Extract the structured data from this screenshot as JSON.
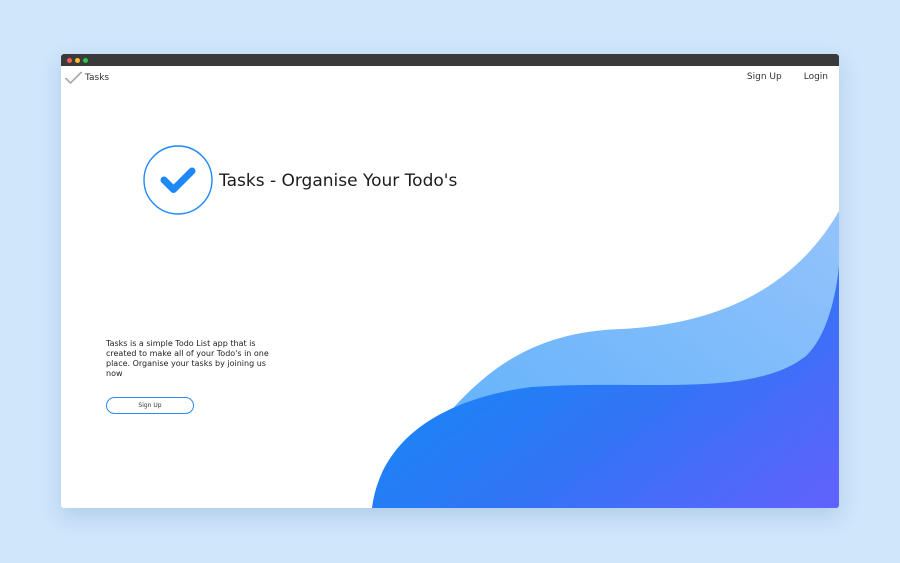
{
  "navbar": {
    "brand": "Tasks",
    "links": [
      "Sign Up",
      "Login"
    ]
  },
  "hero": {
    "title": "Tasks - Organise Your Todo's",
    "description": "Tasks is a simple Todo List app that is created to make all of your Todo's in one place. Organise your tasks by joining us now",
    "cta_label": "Sign Up"
  },
  "icons": {
    "brand": "checkmark-icon",
    "hero": "checkmark-circle-icon"
  },
  "colors": {
    "accent": "#1e88f5",
    "wave_light": "#7ab8fb",
    "wave_dark": "#2d7cf5"
  }
}
